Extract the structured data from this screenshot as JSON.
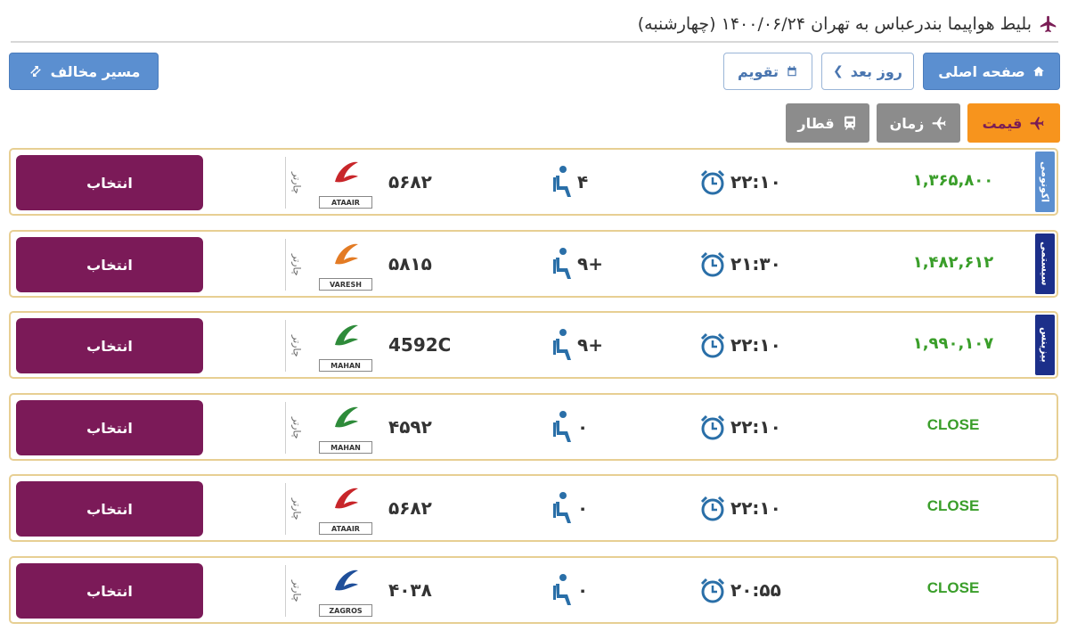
{
  "header": {
    "title": "بلیط هواپیما بندرعباس به تهران ۱۴۰۰/۰۶/۲۴ (چهارشنبه)"
  },
  "toolbar": {
    "home_label": "صفحه اصلی",
    "next_day_label": "روز بعد",
    "calendar_label": "تقویم",
    "reverse_route_label": "مسیر مخالف"
  },
  "tabs": [
    {
      "label": "قیمت",
      "icon": "plane-icon",
      "active": true
    },
    {
      "label": "زمان",
      "icon": "plane-icon",
      "active": false
    },
    {
      "label": "قطار",
      "icon": "train-icon",
      "active": false
    }
  ],
  "flights": [
    {
      "select_label": "انتخاب",
      "flight_type": "چارتر",
      "airline_code": "ATAAIR",
      "airline_color": "#c8262a",
      "flight_no": "۵۶۸۲",
      "seats": "۴",
      "time": "۲۲:۱۰",
      "price": "۱,۳۶۵,۸۰۰",
      "class_label": "اکونومی",
      "class_color": "#5b8fd0"
    },
    {
      "select_label": "انتخاب",
      "flight_type": "چارتر",
      "airline_code": "VARESH",
      "airline_color": "#e37b24",
      "flight_no": "۵۸۱۵",
      "seats": "+۹",
      "time": "۲۱:۳۰",
      "price": "۱,۴۸۲,۶۱۲",
      "class_label": "سیستمی",
      "class_color": "#1c2f8a"
    },
    {
      "select_label": "انتخاب",
      "flight_type": "چارتر",
      "airline_code": "MAHAN",
      "airline_color": "#2e8b3a",
      "flight_no": "4592C",
      "seats": "+۹",
      "time": "۲۲:۱۰",
      "price": "۱,۹۹۰,۱۰۷",
      "class_label": "بیزینس",
      "class_color": "#1c2f8a"
    },
    {
      "select_label": "انتخاب",
      "flight_type": "چارتر",
      "airline_code": "MAHAN",
      "airline_color": "#2e8b3a",
      "flight_no": "۴۵۹۲",
      "seats": "۰",
      "time": "۲۲:۱۰",
      "price": "CLOSE",
      "class_label": "",
      "class_color": ""
    },
    {
      "select_label": "انتخاب",
      "flight_type": "چارتر",
      "airline_code": "ATAAIR",
      "airline_color": "#c8262a",
      "flight_no": "۵۶۸۲",
      "seats": "۰",
      "time": "۲۲:۱۰",
      "price": "CLOSE",
      "class_label": "",
      "class_color": ""
    },
    {
      "select_label": "انتخاب",
      "flight_type": "چارتر",
      "airline_code": "ZAGROS",
      "airline_color": "#1f4f9a",
      "flight_no": "۴۰۳۸",
      "seats": "۰",
      "time": "۲۰:۵۵",
      "price": "CLOSE",
      "class_label": "",
      "class_color": ""
    }
  ],
  "colors": {
    "select_button": "#7b1a58",
    "active_tab": "#f7941d",
    "row_border": "#e7cf93",
    "price_green": "#3a9e2a",
    "icon_blue": "#2a6fa8"
  }
}
